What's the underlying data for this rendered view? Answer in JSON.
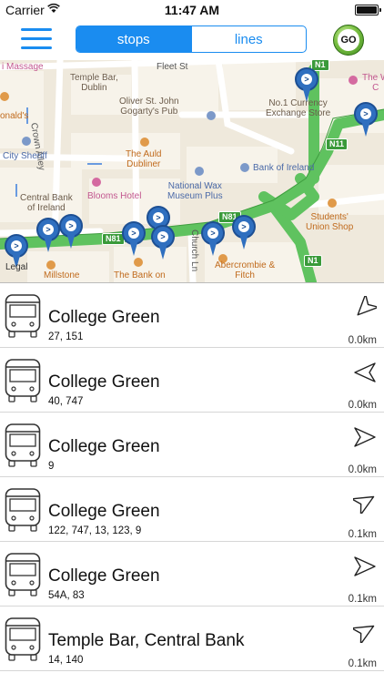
{
  "status_bar": {
    "carrier": "Carrier",
    "time": "11:47 AM"
  },
  "nav": {
    "tabs": [
      {
        "label": "stops",
        "active": true
      },
      {
        "label": "lines",
        "active": false
      }
    ],
    "go_label": "GO",
    "accent_color": "#1a8cf0"
  },
  "map": {
    "labels": {
      "massage": "i Massage",
      "temple_bar": "Temple Bar,\nDublin",
      "fleet_st": "Fleet St",
      "crown_alley": "Crown Alley",
      "oliver": "Oliver St. John\nGogarty's Pub",
      "currency": "No.1 Currency\nExchange Store",
      "mcdonalds": "onald's",
      "city_sheriff": "City Sheriff",
      "auld_dubliner": "The Auld\nDubliner",
      "bank_of_ireland": "Bank of Ireland",
      "central_bank": "Central Bank\nof Ireland",
      "blooms": "Blooms Hotel",
      "wax_museum": "National Wax\nMuseum Plus",
      "students_union": "Students'\nUnion Shop",
      "millstone": "Millstone",
      "bank_on": "The Bank on",
      "church_ln": "Church Ln",
      "abercrombie": "Abercrombie &\nFitch",
      "the_w": "The W\nC",
      "legal": "Legal"
    },
    "road_badges": [
      "N1",
      "N11",
      "N81",
      "N81",
      "N1"
    ]
  },
  "stops": [
    {
      "name": "College Green",
      "routes": "27, 151",
      "distance": "0.0km",
      "bearing": 225
    },
    {
      "name": "College Green",
      "routes": "40, 747",
      "distance": "0.0km",
      "bearing": 180
    },
    {
      "name": "College Green",
      "routes": "9",
      "distance": "0.0km",
      "bearing": 0
    },
    {
      "name": "College Green",
      "routes": "122, 747, 13, 123, 9",
      "distance": "0.1km",
      "bearing": 30
    },
    {
      "name": "College Green",
      "routes": "54A, 83",
      "distance": "0.1km",
      "bearing": 0
    },
    {
      "name": "Temple Bar, Central Bank",
      "routes": "14, 140",
      "distance": "0.1km",
      "bearing": 30
    }
  ]
}
